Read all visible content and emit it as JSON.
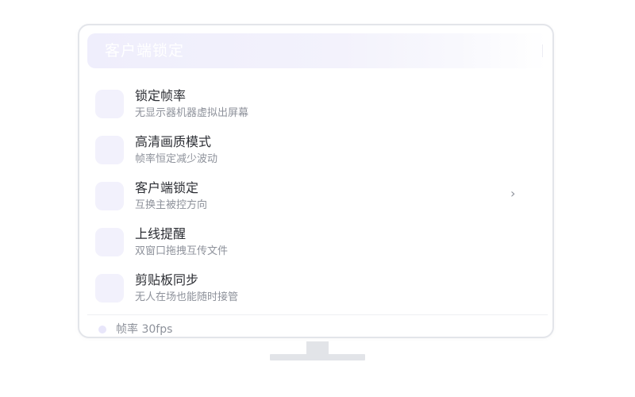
{
  "header": {
    "title": "客户端锁定"
  },
  "list": {
    "items": [
      {
        "title": "锁定帧率",
        "subtitle": "无显示器机器虚拟出屏幕"
      },
      {
        "title": "高清画质模式",
        "subtitle": "帧率恒定减少波动"
      },
      {
        "title": "客户端锁定",
        "subtitle": "互换主被控方向",
        "chevron": "›"
      },
      {
        "title": "上线提醒",
        "subtitle": "双窗口拖拽互传文件"
      },
      {
        "title": "剪贴板同步",
        "subtitle": "无人在场也能随时接管"
      }
    ]
  },
  "status": {
    "text": "帧率 30fps"
  },
  "colors": {
    "accent_tint": "#f2f1fc",
    "header_gradient_start": "#efeefc",
    "text_primary": "#2b2d33",
    "text_secondary": "#8e929b",
    "frame_border": "#e3e5ea"
  }
}
